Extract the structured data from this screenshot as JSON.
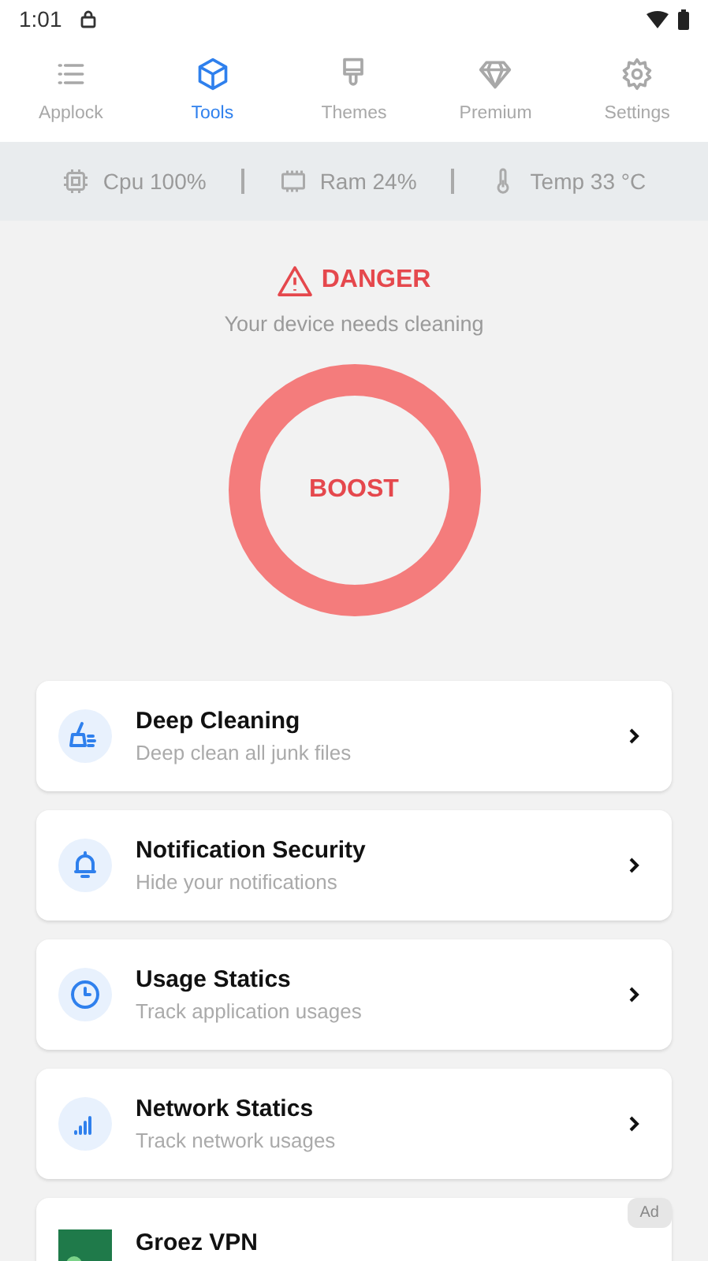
{
  "status_bar": {
    "time": "1:01"
  },
  "tabs": [
    {
      "label": "Applock",
      "kind": "list",
      "selected": false
    },
    {
      "label": "Tools",
      "kind": "cube",
      "selected": true
    },
    {
      "label": "Themes",
      "kind": "brush",
      "selected": false
    },
    {
      "label": "Premium",
      "kind": "diamond",
      "selected": false
    },
    {
      "label": "Settings",
      "kind": "gear",
      "selected": false
    }
  ],
  "stats": [
    {
      "kind": "cpu",
      "label": "Cpu 100%"
    },
    {
      "kind": "ram",
      "label": "Ram 24%"
    },
    {
      "kind": "temp",
      "label": "Temp 33 °C"
    }
  ],
  "alert": {
    "title": "DANGER",
    "message": "Your device needs cleaning"
  },
  "boost": {
    "label": "BOOST"
  },
  "tools": [
    {
      "kind": "broom",
      "title": "Deep Cleaning",
      "subtitle": "Deep clean all junk files"
    },
    {
      "kind": "bell",
      "title": "Notification Security",
      "subtitle": "Hide your notifications"
    },
    {
      "kind": "clock",
      "title": "Usage Statics",
      "subtitle": "Track application usages"
    },
    {
      "kind": "signal",
      "title": "Network Statics",
      "subtitle": "Track network usages"
    }
  ],
  "ad": {
    "title": "Groez VPN",
    "badge": "Ad"
  }
}
